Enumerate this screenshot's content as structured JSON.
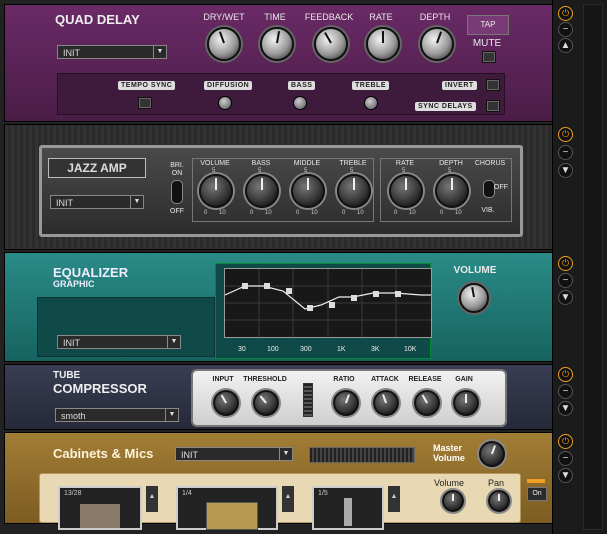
{
  "quad_delay": {
    "title": "QUAD DELAY",
    "preset": "INIT",
    "knobs": [
      "DRY/WET",
      "TIME",
      "FEEDBACK",
      "RATE",
      "DEPTH"
    ],
    "tap": "TAP",
    "mute": "MUTE",
    "toggles": [
      "TEMPO SYNC",
      "DIFFUSION",
      "BASS",
      "TREBLE",
      "INVERT",
      "SYNC DELAYS"
    ]
  },
  "jazz_amp": {
    "title": "JAZZ AMP",
    "preset": "INIT",
    "bri_label": "BRI.",
    "bri_on": "ON",
    "bri_off": "OFF",
    "knobs": [
      "VOLUME",
      "BASS",
      "MIDDLE",
      "TREBLE",
      "RATE",
      "DEPTH"
    ],
    "scale_min": "0",
    "scale_mid": "5",
    "scale_max": "10",
    "chorus": "CHORUS",
    "chorus_off": "OFF",
    "vib": "VIB."
  },
  "equalizer": {
    "title": "EQUALIZER",
    "subtitle": "GRAPHIC",
    "preset": "INIT",
    "volume": "VOLUME",
    "bands": [
      "30",
      "100",
      "300",
      "1K",
      "3K",
      "10K"
    ]
  },
  "compressor": {
    "title_small": "TUBE",
    "title": "COMPRESSOR",
    "preset": "smoth",
    "knobs": [
      "INPUT",
      "THRESHOLD",
      "RATIO",
      "ATTACK",
      "RELEASE",
      "GAIN"
    ]
  },
  "cabinets": {
    "title": "Cabinets & Mics",
    "preset": "INIT",
    "master_volume": "Master Volume",
    "slots": [
      "13/28",
      "1/4",
      "1/5"
    ],
    "volume": "Volume",
    "pan": "Pan",
    "on": "On"
  },
  "colors": {
    "delay": "#5b2457",
    "amp": "#3c3c3c",
    "eq": "#1d6d6a",
    "comp": "#2f3244",
    "cab": "#8c6a2c",
    "power": "#f0a020"
  }
}
